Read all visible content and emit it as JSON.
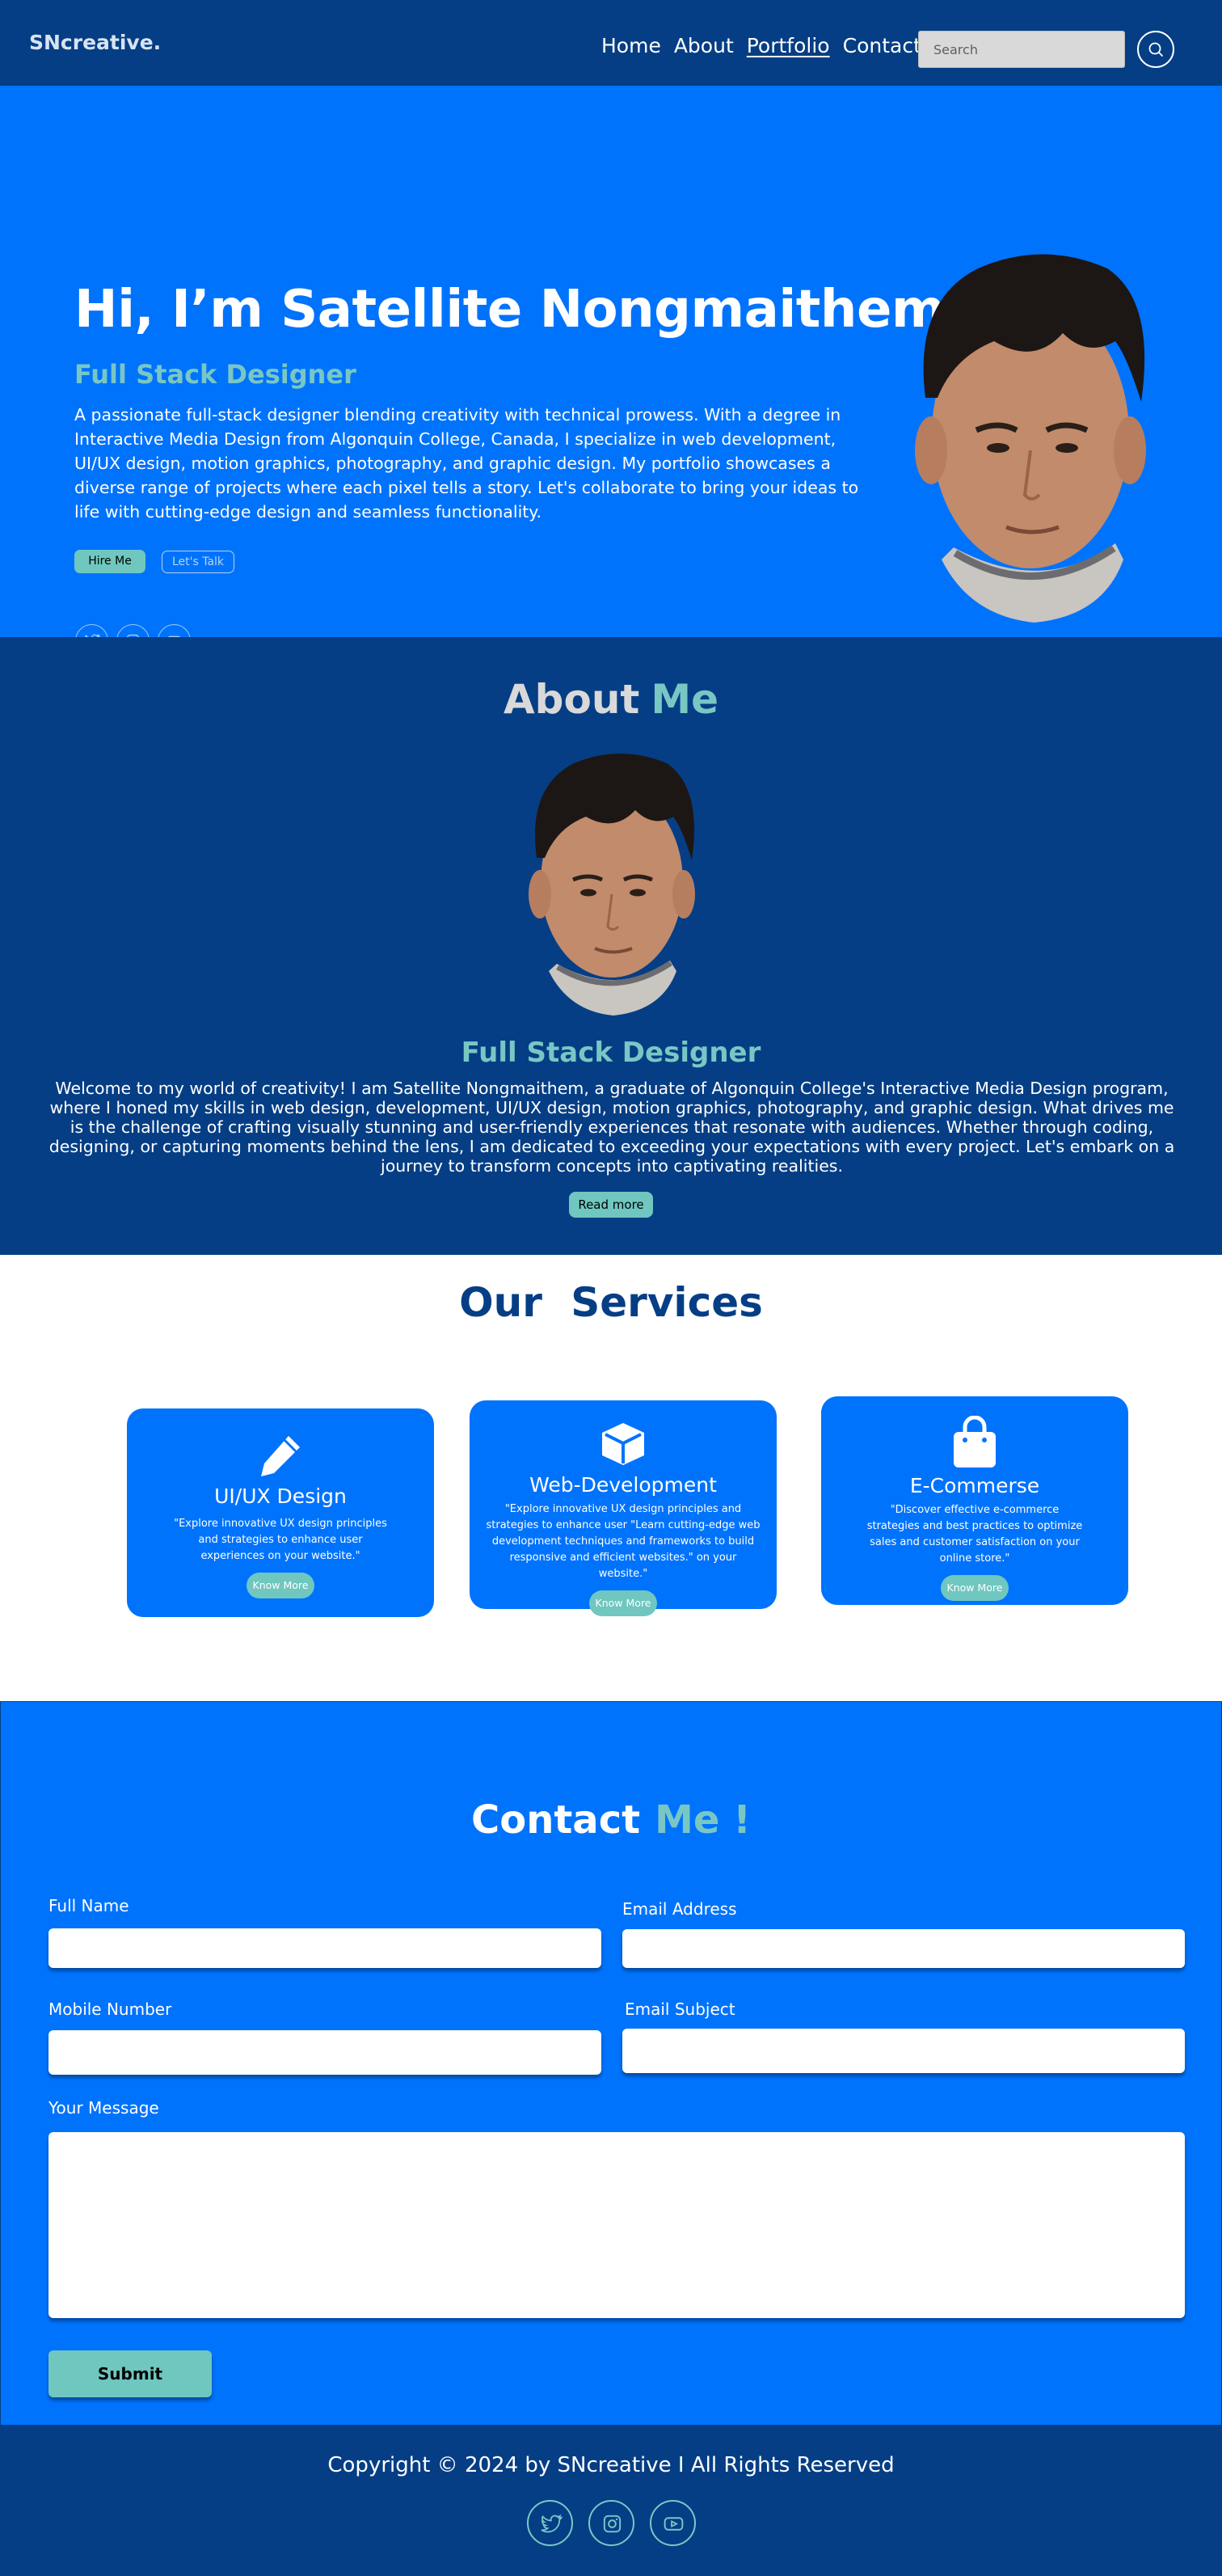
{
  "nav": {
    "brand": "SNcreative.",
    "links": [
      "Home",
      "About",
      "Portfolio",
      "Contact"
    ],
    "active_link": "Portfolio",
    "search_placeholder": "Search"
  },
  "hero": {
    "heading": "Hi, I’m Satellite Nongmaithem",
    "subheading": "Full Stack Designer",
    "intro": "A passionate full-stack designer blending creativity with technical prowess. With a degree in Interactive Media Design from Algonquin College, Canada, I specialize in web development, UI/UX design, motion graphics, photography, and graphic design. My portfolio showcases a diverse range of projects where each pixel tells a story. Let's collaborate to bring your ideas to life with cutting-edge design and seamless functionality.",
    "hire_label": "Hire Me",
    "talk_label": "Let's Talk",
    "social_icons": [
      "twitter-icon",
      "instagram-icon",
      "youtube-icon"
    ]
  },
  "about": {
    "title": "About",
    "title_accent": "Me",
    "role": "Full Stack Designer",
    "body": "Welcome to my world of creativity! I am Satellite Nongmaithem, a graduate of Algonquin College's Interactive Media Design program, where I honed my skills in web design, development, UI/UX design, motion graphics, photography, and graphic design. What drives me is the challenge of crafting visually stunning and user-friendly experiences that resonate with audiences. Whether through coding, designing, or capturing moments behind the lens, I am dedicated to exceeding your expectations with every project. Let's embark on a journey to transform concepts into captivating realities.",
    "read_more_label": "Read more"
  },
  "services": {
    "title": "Our Services",
    "cards": [
      {
        "icon": "pencil-icon",
        "title": "UI/UX Design",
        "description": "\"Explore innovative UX design principles and strategies to enhance user experiences on your website.\"",
        "button": "Know More"
      },
      {
        "icon": "box-icon",
        "title": "Web-Development",
        "description": "\"Explore innovative UX design principles and strategies to enhance user \"Learn cutting-edge web development techniques and frameworks to build responsive and efficient websites.\" on your website.\"",
        "button": "Know More"
      },
      {
        "icon": "shopping-bag-icon",
        "title": "E-Commerse",
        "description": "\"Discover effective e-commerce strategies and best practices to optimize sales and customer satisfaction on your online store.\"",
        "button": "Know More"
      }
    ]
  },
  "contact": {
    "title": "Contact",
    "title_accent": "Me !",
    "labels": {
      "full_name": "Full Name",
      "email": "Email Address",
      "mobile": "Mobile Number",
      "subject": "Email Subject",
      "message": "Your Message"
    },
    "submit_label": "Submit"
  },
  "footer": {
    "copyright": "Copyright © 2024 by SNcreative I All Rights Reserved",
    "social_icons": [
      "twitter-icon",
      "instagram-icon",
      "youtube-icon"
    ]
  },
  "colors": {
    "navy": "#053e85",
    "blue": "#0073fd",
    "teal": "#79c7c4",
    "button_teal": "#6fc7c0"
  }
}
